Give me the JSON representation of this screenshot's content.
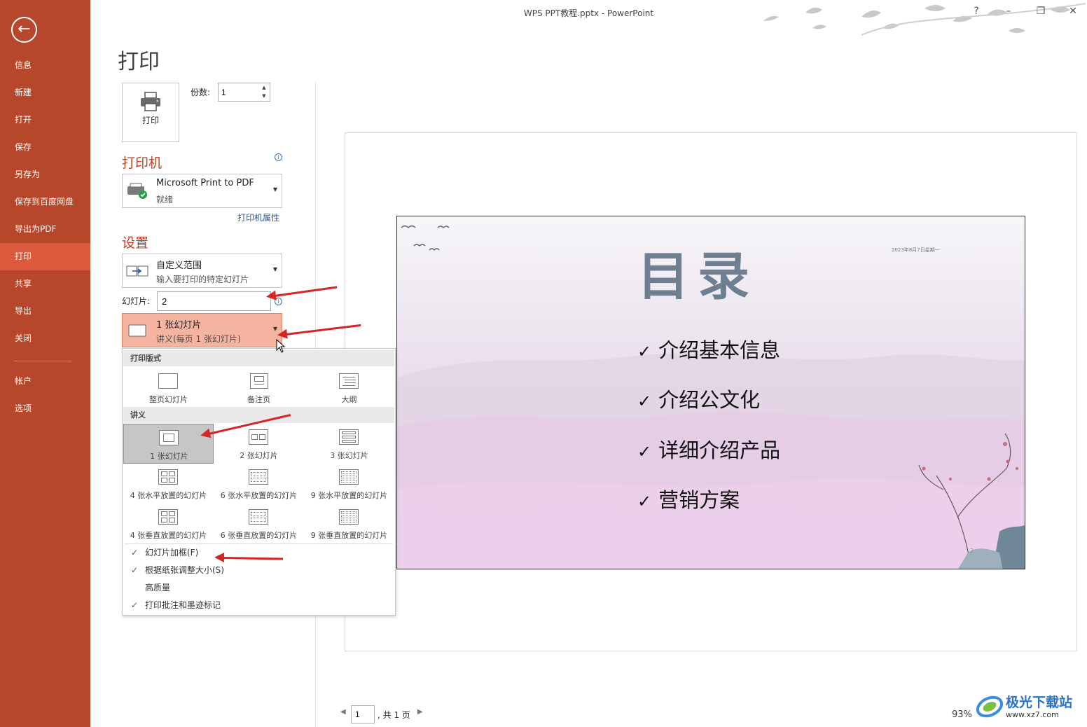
{
  "window": {
    "title": "WPS PPT教程.pptx - PowerPoint",
    "help": "?",
    "minimize": "–",
    "restore": "❐",
    "close": "✕"
  },
  "sidebar": {
    "back_icon": "back-arrow-icon",
    "items": [
      {
        "label": "信息"
      },
      {
        "label": "新建"
      },
      {
        "label": "打开"
      },
      {
        "label": "保存"
      },
      {
        "label": "另存为"
      },
      {
        "label": "保存到百度网盘"
      },
      {
        "label": "导出为PDF"
      },
      {
        "label": "打印",
        "active": true
      },
      {
        "label": "共享"
      },
      {
        "label": "导出"
      },
      {
        "label": "关闭"
      },
      {
        "label": "帐户"
      },
      {
        "label": "选项"
      }
    ],
    "bg_color": "#b7472a",
    "active_color": "#dc5a3c"
  },
  "page": {
    "title": "打印",
    "print_button": "打印",
    "copies_label": "份数:",
    "copies_value": "1"
  },
  "printer": {
    "section": "打印机",
    "name": "Microsoft Print to PDF",
    "status": "就绪",
    "properties_link": "打印机属性"
  },
  "settings": {
    "section": "设置",
    "range_title": "自定义范围",
    "range_desc": "输入要打印的特定幻灯片",
    "slides_label": "幻灯片:",
    "slides_value": "2",
    "layout_title": "1 张幻灯片",
    "layout_desc": "讲义(每页 1 张幻灯片)"
  },
  "layout_menu": {
    "header_print_layout": "打印版式",
    "print_layouts": [
      "整页幻灯片",
      "备注页",
      "大纲"
    ],
    "header_handouts": "讲义",
    "handouts": [
      "1 张幻灯片",
      "2 张幻灯片",
      "3 张幻灯片",
      "4 张水平放置的幻灯片",
      "6 张水平放置的幻灯片",
      "9 张水平放置的幻灯片",
      "4 张垂直放置的幻灯片",
      "6 张垂直放置的幻灯片",
      "9 张垂直放置的幻灯片"
    ],
    "selected_handout": "1 张幻灯片",
    "options": [
      {
        "label": "幻灯片加框(F)",
        "checked": true
      },
      {
        "label": "根据纸张调整大小(S)",
        "checked": true
      },
      {
        "label": "高质量",
        "checked": false
      },
      {
        "label": "打印批注和墨迹标记",
        "checked": true
      }
    ]
  },
  "preview": {
    "slide_title": "目录",
    "date": "2023年8月7日星期一",
    "bullets": [
      "介绍基本信息",
      "介绍公文化",
      "详细介绍产品",
      "营销方案"
    ],
    "slide_number": "2",
    "check": "✓"
  },
  "footer": {
    "page_value": "1",
    "page_total": ", 共 1 页",
    "zoom": "93%",
    "prev": "◀",
    "next": "▶"
  },
  "watermark": {
    "title": "极光下载站",
    "url": "www.xz7.com"
  },
  "accent_color": "#c43e1c",
  "annotation_color": "#d52525"
}
